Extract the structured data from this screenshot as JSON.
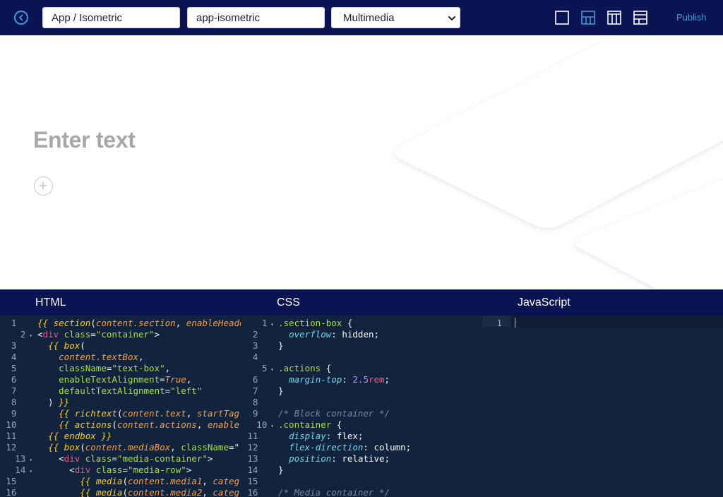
{
  "topbar": {
    "title_value": "App / Isometric",
    "slug_value": "app-isometric",
    "category_selected": "Multimedia",
    "publish_label": "Publish",
    "accent": "#3a9bd8",
    "background": "#0b1452",
    "layout_icons": [
      "layout-single-icon",
      "layout-split-bottom-icon",
      "layout-three-columns-icon",
      "layout-sidebar-icon"
    ],
    "active_layout": "layout-split-bottom-icon"
  },
  "preview": {
    "headline_placeholder": "Enter text",
    "add_icon": "plus-icon"
  },
  "editors": {
    "html": {
      "title": "HTML",
      "lines": [
        "{{ section(content.section, enableHeader",
        "<div class=\"container\">",
        "  {{ box(",
        "    content.textBox,",
        "    className=\"text-box\",",
        "    enableTextAlignment=True,",
        "    defaultTextAlignment=\"left\"",
        "  ) }}",
        "    {{ richtext(content.text, startTag",
        "    {{ actions(content.actions, enable",
        "  {{ endbox }}",
        "  {{ box(content.mediaBox, className=\"",
        "    <div class=\"media-container\">",
        "      <div class=\"media-row\">",
        "        {{ media(content.media1, categ",
        "        {{ media(content.media2, categ"
      ]
    },
    "css": {
      "title": "CSS",
      "lines": [
        ".section-box {",
        "  overflow: hidden;",
        "}",
        "",
        ".actions {",
        "  margin-top: 2.5rem;",
        "}",
        "",
        "/* Block container */",
        ".container {",
        "  display: flex;",
        "  flex-direction: column;",
        "  position: relative;",
        "}",
        "",
        "/* Media container */"
      ]
    },
    "js": {
      "title": "JavaScript",
      "lines": [
        ""
      ]
    }
  }
}
